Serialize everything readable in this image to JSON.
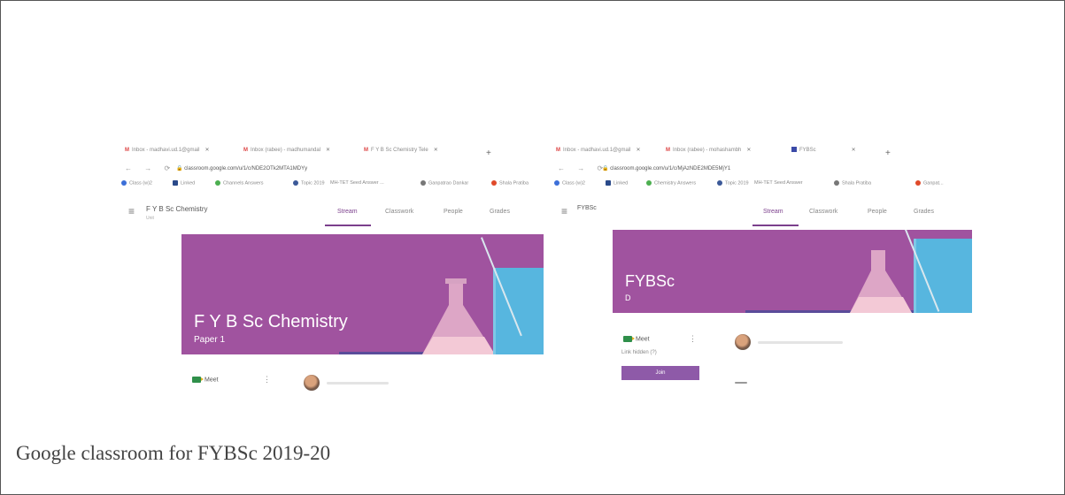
{
  "caption": "Google classroom for FYBSc 2019-20",
  "left": {
    "tabs": [
      {
        "label": "Inbox - madhavi.ud.1@gmail",
        "icon": "gmail-icon"
      },
      {
        "label": "Inbox (rabee) - madhumandal",
        "icon": "gmail-icon"
      },
      {
        "label": "F Y B Sc Chemistry Tele",
        "icon": "gmail-icon"
      }
    ],
    "url": "classroom.google.com/u/1/c/NDE2OTk2MTA1MDYy",
    "bookmarks": [
      "Class (w)2",
      "Linked",
      "Channels Answers",
      "Topic 2019",
      "MH-TET Seed Answer ...",
      "Ganpatrao Dankar",
      "Shala Pratiba"
    ],
    "class_name": "F Y B Sc Chemistry",
    "class_sub": "Unit",
    "nav": [
      "Stream",
      "Classwork",
      "People",
      "Grades"
    ],
    "banner_title": "F Y B Sc Chemistry",
    "banner_subtitle": "Paper 1",
    "meet_label": "Meet"
  },
  "right": {
    "tabs": [
      {
        "label": "Inbox - madhavi.ud.1@gmail",
        "icon": "gmail-icon"
      },
      {
        "label": "Inbox (rabee) - mohashambh",
        "icon": "gmail-icon"
      },
      {
        "label": "FYBSc",
        "icon": "classroom-icon"
      }
    ],
    "url": "classroom.google.com/u/1/c/MjAzNDE2MDE5MjY1",
    "bookmarks": [
      "Class (w)2",
      "Linked",
      "Chemistry Answers",
      "Topic 2019",
      "MH-TET Seed Answer",
      "Shala Pratiba",
      "Ganpat..."
    ],
    "class_name": "FYBSc",
    "nav": [
      "Stream",
      "Classwork",
      "People",
      "Grades"
    ],
    "banner_title": "FYBSc",
    "banner_subtitle": "D",
    "meet_label": "Meet",
    "meet_link": "Link hidden (?)",
    "join_label": "Join"
  }
}
